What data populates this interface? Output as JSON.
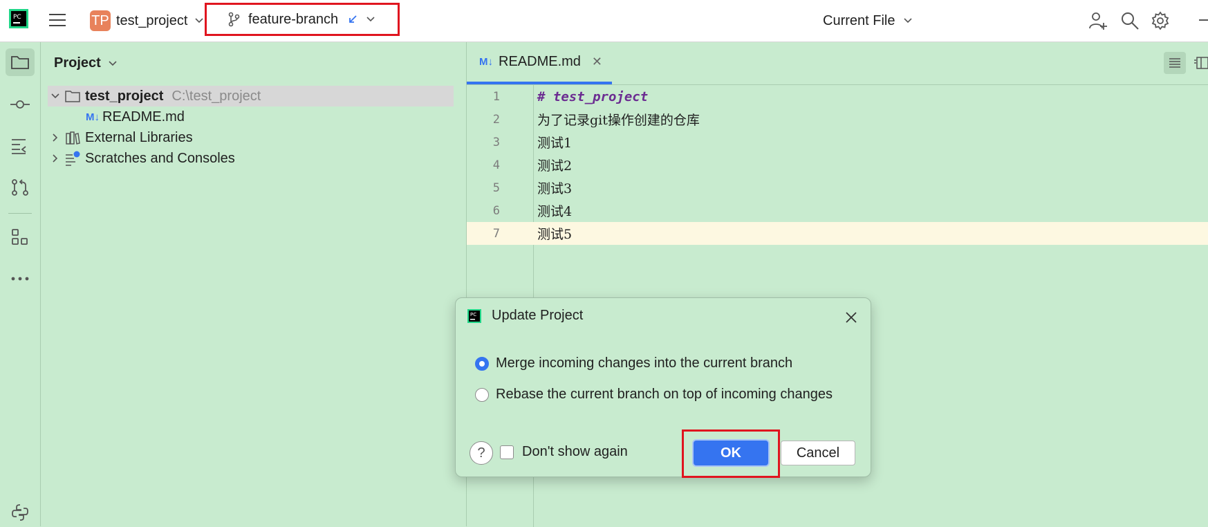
{
  "titlebar": {
    "project_badge": "TP",
    "project_name": "test_project",
    "branch_name": "feature-branch",
    "run_config": "Current File"
  },
  "toolstrip": {
    "items": [
      "folder-icon",
      "commit-icon",
      "structure-icon",
      "pull-requests-icon",
      "plugins-icon",
      "more-icon",
      "python-icon"
    ]
  },
  "project_panel": {
    "title": "Project",
    "tree": [
      {
        "label": "test_project",
        "hint": "C:\\test_project",
        "icon": "folder-icon"
      },
      {
        "label": "README.md",
        "icon": "markdown-icon",
        "badge": "M↓"
      },
      {
        "label": "External Libraries",
        "icon": "library-icon"
      },
      {
        "label": "Scratches and Consoles",
        "icon": "scratches-icon"
      }
    ]
  },
  "editor": {
    "tab_badge": "M↓",
    "tab_label": "README.md",
    "lines": [
      {
        "no": "1",
        "text": "# test_project"
      },
      {
        "no": "2",
        "text": "为了记录git操作创建的仓库"
      },
      {
        "no": "3",
        "text": "测试1"
      },
      {
        "no": "4",
        "text": "测试2"
      },
      {
        "no": "5",
        "text": "测试3"
      },
      {
        "no": "6",
        "text": "测试4"
      },
      {
        "no": "7",
        "text": "测试5"
      }
    ]
  },
  "dialog": {
    "title": "Update Project",
    "options": [
      {
        "label": "Merge incoming changes into the current branch",
        "checked": true
      },
      {
        "label": "Rebase the current branch on top of incoming changes",
        "checked": false
      }
    ],
    "help": "?",
    "dont_show_again": "Don't show again",
    "ok": "OK",
    "cancel": "Cancel"
  },
  "colors": {
    "background": "#c8ebcf",
    "accent": "#3574f0",
    "highlight_box": "#e0151f",
    "project_badge": "#e8825b"
  }
}
